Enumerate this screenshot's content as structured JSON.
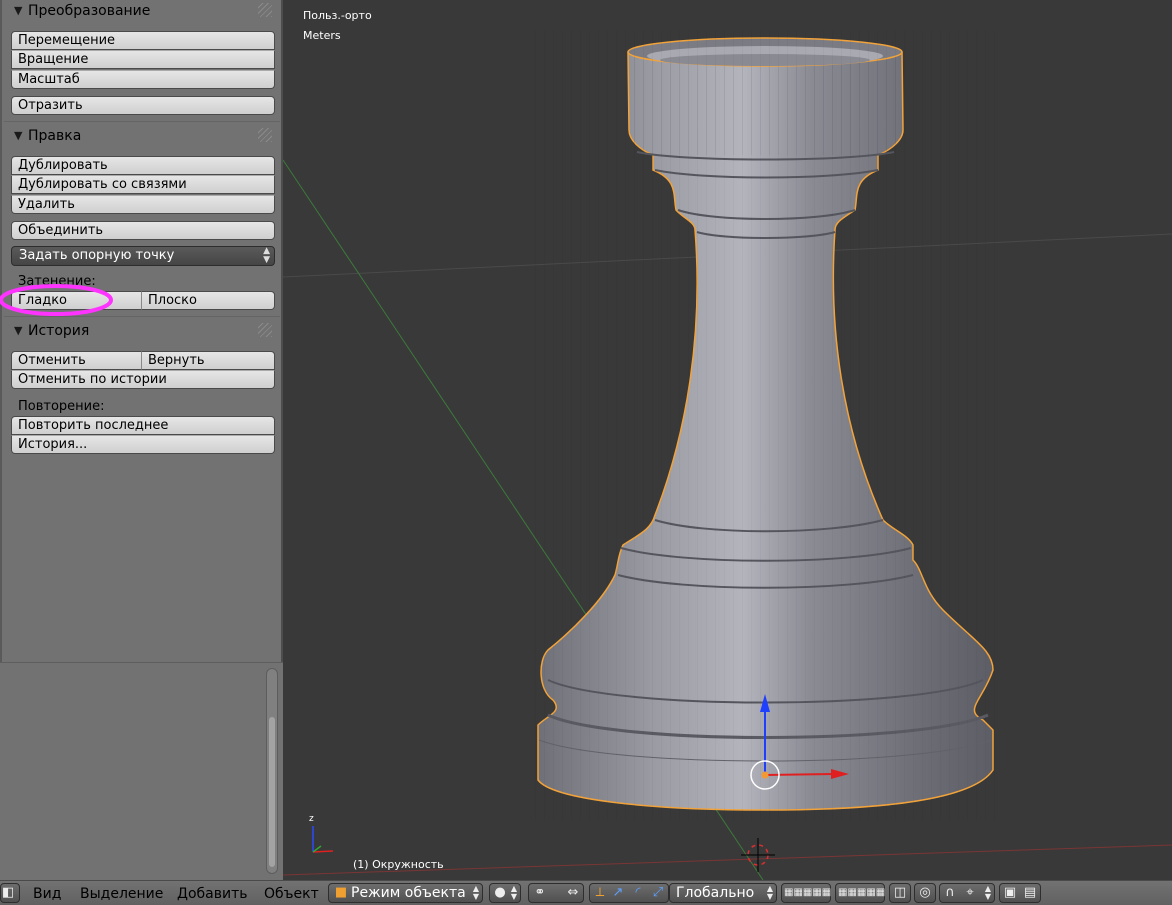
{
  "toolshelf": {
    "transform": {
      "title": "Преобразование",
      "move": "Перемещение",
      "rotate": "Вращение",
      "scale": "Масштаб",
      "mirror": "Отразить"
    },
    "edit": {
      "title": "Правка",
      "duplicate": "Дублировать",
      "duplicate_linked": "Дублировать со связями",
      "delete": "Удалить",
      "join": "Объединить",
      "set_origin": "Задать опорную точку",
      "shading_label": "Затенение:",
      "smooth": "Гладко",
      "flat": "Плоско"
    },
    "history": {
      "title": "История",
      "undo": "Отменить",
      "redo": "Вернуть",
      "undo_history": "Отменить по истории",
      "repeat_label": "Повторение:",
      "repeat_last": "Повторить последнее",
      "repeat_history": "История..."
    }
  },
  "viewport": {
    "view_name": "Польз.-орто",
    "units": "Meters",
    "active_object": "(1) Окружность",
    "axis_z": "z",
    "annotation_color": "#ff33ff",
    "selection_outline_color": "#f2a33a",
    "object_color": "#8e8e99"
  },
  "header": {
    "menu_view": "Вид",
    "menu_select": "Выделение",
    "menu_add": "Добавить",
    "menu_object": "Объект",
    "mode": "Режим объекта",
    "orientation": "Глобально"
  }
}
